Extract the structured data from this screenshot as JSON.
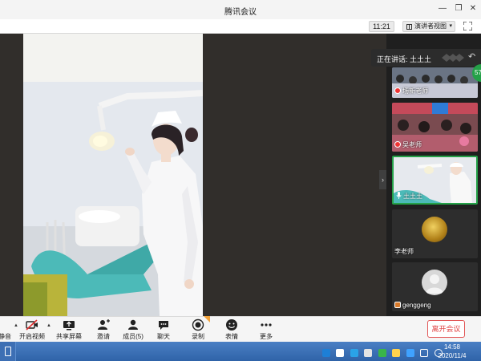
{
  "window": {
    "title": "腾讯会议",
    "minimize": "—",
    "restore": "❐",
    "close": "✕"
  },
  "topbar": {
    "time": "11:21",
    "view_label": "演讲者视图",
    "view_caret": "▾"
  },
  "sidebar": {
    "speaking_text": "正在讲话: 土土土",
    "participant_count_badge": "57",
    "tiles": [
      {
        "name": "场新老师"
      },
      {
        "name": "吴老师"
      },
      {
        "name": "土土土"
      },
      {
        "name": "李老师"
      },
      {
        "name": "genggeng"
      }
    ]
  },
  "toolbar": {
    "mute_label": "静音",
    "video_label": "开启视频",
    "share_label": "共享屏幕",
    "invite_label": "邀请",
    "members_label": "成员(5)",
    "chat_label": "聊天",
    "record_label": "录制",
    "emoji_label": "表情",
    "more_label": "更多",
    "leave_label": "离开会议"
  },
  "taskbar": {
    "time": "14:58",
    "date": "2020/11/4"
  },
  "colors": {
    "accent_green": "#24a148",
    "leave_red": "#e04040",
    "taskbar_blue": "#2f63a8"
  }
}
